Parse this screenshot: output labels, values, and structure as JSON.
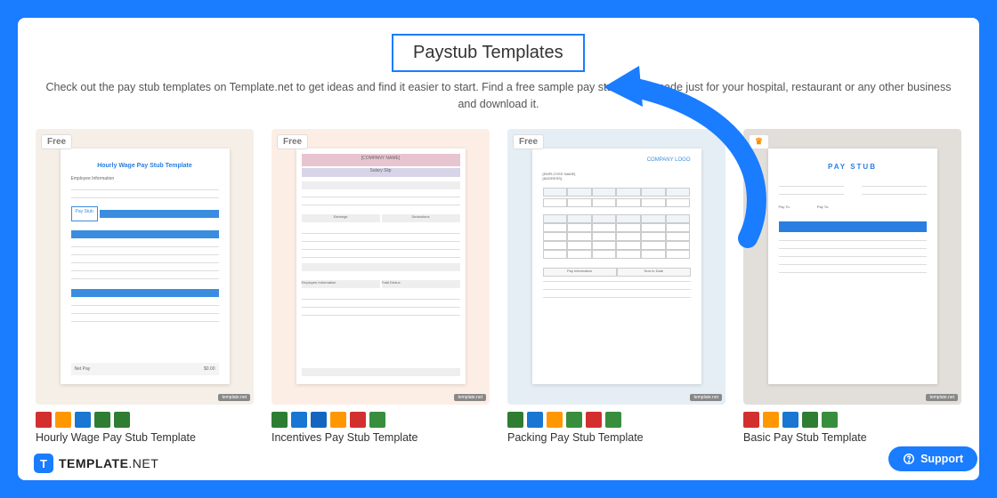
{
  "header": "Paystub Templates",
  "description": "Check out the pay stub templates on Template.net to get ideas and find it easier to start. Find a free sample pay stub that is made just for your hospital, restaurant or any other business and download it.",
  "cards": [
    {
      "badge": "Free",
      "title": "Hourly Wage Pay Stub Template",
      "preview_heading": "Hourly Wage Pay Stub Template"
    },
    {
      "badge": "Free",
      "title": "Incentives Pay Stub Template",
      "preview_heading": "Salary Slip"
    },
    {
      "badge": "Free",
      "title": "Packing Pay Stub Template",
      "preview_heading": "COMPANY LOGO"
    },
    {
      "badge": "crown",
      "title": "Basic Pay Stub Template",
      "preview_heading": "PAY STUB"
    }
  ],
  "icon_sets": {
    "set_a": [
      "pdf",
      "or",
      "wd",
      "xl",
      "xl"
    ],
    "set_b": [
      "xl",
      "wd",
      "gd",
      "or",
      "pdf",
      "gs"
    ],
    "set_c": [
      "xl",
      "wd",
      "or",
      "gs",
      "pdf",
      "gs"
    ],
    "set_d": [
      "pdf",
      "or",
      "wd",
      "xl",
      "gs"
    ]
  },
  "brand": {
    "logo_letter": "T",
    "name_bold": "TEMPLATE",
    "name_light": ".NET"
  },
  "support": {
    "label": "Support"
  },
  "thumb_label": "template.net"
}
